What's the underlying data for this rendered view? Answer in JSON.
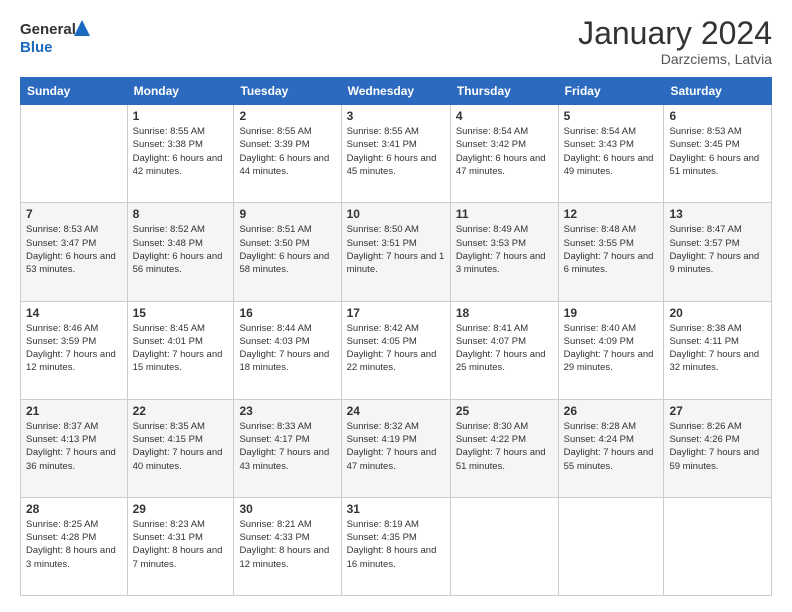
{
  "logo": {
    "line1": "General",
    "line2": "Blue"
  },
  "title": "January 2024",
  "subtitle": "Darzciems, Latvia",
  "days_of_week": [
    "Sunday",
    "Monday",
    "Tuesday",
    "Wednesday",
    "Thursday",
    "Friday",
    "Saturday"
  ],
  "weeks": [
    [
      {
        "day": "",
        "sunrise": "",
        "sunset": "",
        "daylight": ""
      },
      {
        "day": "1",
        "sunrise": "Sunrise: 8:55 AM",
        "sunset": "Sunset: 3:38 PM",
        "daylight": "Daylight: 6 hours and 42 minutes."
      },
      {
        "day": "2",
        "sunrise": "Sunrise: 8:55 AM",
        "sunset": "Sunset: 3:39 PM",
        "daylight": "Daylight: 6 hours and 44 minutes."
      },
      {
        "day": "3",
        "sunrise": "Sunrise: 8:55 AM",
        "sunset": "Sunset: 3:41 PM",
        "daylight": "Daylight: 6 hours and 45 minutes."
      },
      {
        "day": "4",
        "sunrise": "Sunrise: 8:54 AM",
        "sunset": "Sunset: 3:42 PM",
        "daylight": "Daylight: 6 hours and 47 minutes."
      },
      {
        "day": "5",
        "sunrise": "Sunrise: 8:54 AM",
        "sunset": "Sunset: 3:43 PM",
        "daylight": "Daylight: 6 hours and 49 minutes."
      },
      {
        "day": "6",
        "sunrise": "Sunrise: 8:53 AM",
        "sunset": "Sunset: 3:45 PM",
        "daylight": "Daylight: 6 hours and 51 minutes."
      }
    ],
    [
      {
        "day": "7",
        "sunrise": "Sunrise: 8:53 AM",
        "sunset": "Sunset: 3:47 PM",
        "daylight": "Daylight: 6 hours and 53 minutes."
      },
      {
        "day": "8",
        "sunrise": "Sunrise: 8:52 AM",
        "sunset": "Sunset: 3:48 PM",
        "daylight": "Daylight: 6 hours and 56 minutes."
      },
      {
        "day": "9",
        "sunrise": "Sunrise: 8:51 AM",
        "sunset": "Sunset: 3:50 PM",
        "daylight": "Daylight: 6 hours and 58 minutes."
      },
      {
        "day": "10",
        "sunrise": "Sunrise: 8:50 AM",
        "sunset": "Sunset: 3:51 PM",
        "daylight": "Daylight: 7 hours and 1 minute."
      },
      {
        "day": "11",
        "sunrise": "Sunrise: 8:49 AM",
        "sunset": "Sunset: 3:53 PM",
        "daylight": "Daylight: 7 hours and 3 minutes."
      },
      {
        "day": "12",
        "sunrise": "Sunrise: 8:48 AM",
        "sunset": "Sunset: 3:55 PM",
        "daylight": "Daylight: 7 hours and 6 minutes."
      },
      {
        "day": "13",
        "sunrise": "Sunrise: 8:47 AM",
        "sunset": "Sunset: 3:57 PM",
        "daylight": "Daylight: 7 hours and 9 minutes."
      }
    ],
    [
      {
        "day": "14",
        "sunrise": "Sunrise: 8:46 AM",
        "sunset": "Sunset: 3:59 PM",
        "daylight": "Daylight: 7 hours and 12 minutes."
      },
      {
        "day": "15",
        "sunrise": "Sunrise: 8:45 AM",
        "sunset": "Sunset: 4:01 PM",
        "daylight": "Daylight: 7 hours and 15 minutes."
      },
      {
        "day": "16",
        "sunrise": "Sunrise: 8:44 AM",
        "sunset": "Sunset: 4:03 PM",
        "daylight": "Daylight: 7 hours and 18 minutes."
      },
      {
        "day": "17",
        "sunrise": "Sunrise: 8:42 AM",
        "sunset": "Sunset: 4:05 PM",
        "daylight": "Daylight: 7 hours and 22 minutes."
      },
      {
        "day": "18",
        "sunrise": "Sunrise: 8:41 AM",
        "sunset": "Sunset: 4:07 PM",
        "daylight": "Daylight: 7 hours and 25 minutes."
      },
      {
        "day": "19",
        "sunrise": "Sunrise: 8:40 AM",
        "sunset": "Sunset: 4:09 PM",
        "daylight": "Daylight: 7 hours and 29 minutes."
      },
      {
        "day": "20",
        "sunrise": "Sunrise: 8:38 AM",
        "sunset": "Sunset: 4:11 PM",
        "daylight": "Daylight: 7 hours and 32 minutes."
      }
    ],
    [
      {
        "day": "21",
        "sunrise": "Sunrise: 8:37 AM",
        "sunset": "Sunset: 4:13 PM",
        "daylight": "Daylight: 7 hours and 36 minutes."
      },
      {
        "day": "22",
        "sunrise": "Sunrise: 8:35 AM",
        "sunset": "Sunset: 4:15 PM",
        "daylight": "Daylight: 7 hours and 40 minutes."
      },
      {
        "day": "23",
        "sunrise": "Sunrise: 8:33 AM",
        "sunset": "Sunset: 4:17 PM",
        "daylight": "Daylight: 7 hours and 43 minutes."
      },
      {
        "day": "24",
        "sunrise": "Sunrise: 8:32 AM",
        "sunset": "Sunset: 4:19 PM",
        "daylight": "Daylight: 7 hours and 47 minutes."
      },
      {
        "day": "25",
        "sunrise": "Sunrise: 8:30 AM",
        "sunset": "Sunset: 4:22 PM",
        "daylight": "Daylight: 7 hours and 51 minutes."
      },
      {
        "day": "26",
        "sunrise": "Sunrise: 8:28 AM",
        "sunset": "Sunset: 4:24 PM",
        "daylight": "Daylight: 7 hours and 55 minutes."
      },
      {
        "day": "27",
        "sunrise": "Sunrise: 8:26 AM",
        "sunset": "Sunset: 4:26 PM",
        "daylight": "Daylight: 7 hours and 59 minutes."
      }
    ],
    [
      {
        "day": "28",
        "sunrise": "Sunrise: 8:25 AM",
        "sunset": "Sunset: 4:28 PM",
        "daylight": "Daylight: 8 hours and 3 minutes."
      },
      {
        "day": "29",
        "sunrise": "Sunrise: 8:23 AM",
        "sunset": "Sunset: 4:31 PM",
        "daylight": "Daylight: 8 hours and 7 minutes."
      },
      {
        "day": "30",
        "sunrise": "Sunrise: 8:21 AM",
        "sunset": "Sunset: 4:33 PM",
        "daylight": "Daylight: 8 hours and 12 minutes."
      },
      {
        "day": "31",
        "sunrise": "Sunrise: 8:19 AM",
        "sunset": "Sunset: 4:35 PM",
        "daylight": "Daylight: 8 hours and 16 minutes."
      },
      {
        "day": "",
        "sunrise": "",
        "sunset": "",
        "daylight": ""
      },
      {
        "day": "",
        "sunrise": "",
        "sunset": "",
        "daylight": ""
      },
      {
        "day": "",
        "sunrise": "",
        "sunset": "",
        "daylight": ""
      }
    ]
  ]
}
